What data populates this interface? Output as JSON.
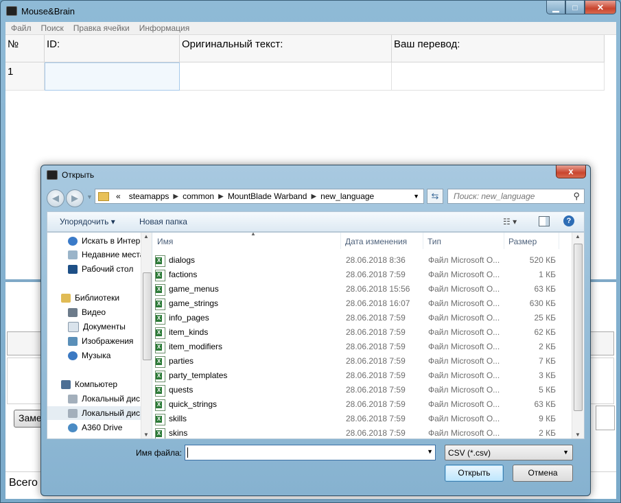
{
  "main_window": {
    "title": "Mouse&Brain",
    "menu": [
      "Файл",
      "Поиск",
      "Правка ячейки",
      "Информация"
    ],
    "grid": {
      "headers": [
        "№",
        "ID:",
        "Оригинальный текст:",
        "Ваш перевод:"
      ],
      "rows": [
        [
          "1",
          "",
          "",
          ""
        ]
      ]
    },
    "replace_button_label": "Заме",
    "status_text": "Всего"
  },
  "dialog": {
    "title": "Открыть",
    "close_label": "x",
    "breadcrumb": [
      "«",
      "steamapps",
      "common",
      "MountBlade Warband",
      "new_language"
    ],
    "search_placeholder": "Поиск: new_language",
    "toolbar": {
      "organize": "Упорядочить",
      "new_folder": "Новая папка"
    },
    "nav_items": [
      {
        "label": "Искать в Интер",
        "icon": "search-icon"
      },
      {
        "label": "Недавние места",
        "icon": "recent-places-icon"
      },
      {
        "label": "Рабочий стол",
        "icon": "desktop-icon"
      },
      {
        "label": "Библиотеки",
        "icon": "libraries-icon"
      },
      {
        "label": "Видео",
        "icon": "video-icon"
      },
      {
        "label": "Документы",
        "icon": "documents-icon"
      },
      {
        "label": "Изображения",
        "icon": "pictures-icon"
      },
      {
        "label": "Музыка",
        "icon": "music-icon"
      },
      {
        "label": "Компьютер",
        "icon": "computer-icon"
      },
      {
        "label": "Локальный дис",
        "icon": "drive-icon"
      },
      {
        "label": "Локальный дис",
        "icon": "drive-icon"
      },
      {
        "label": "A360 Drive",
        "icon": "cloud-drive-icon"
      }
    ],
    "columns": [
      "Имя",
      "Дата изменения",
      "Тип",
      "Размер"
    ],
    "files": [
      {
        "name": "dialogs",
        "date": "28.06.2018 8:36",
        "type": "Файл Microsoft O...",
        "size": "520 КБ"
      },
      {
        "name": "factions",
        "date": "28.06.2018 7:59",
        "type": "Файл Microsoft O...",
        "size": "1 КБ"
      },
      {
        "name": "game_menus",
        "date": "28.06.2018 15:56",
        "type": "Файл Microsoft O...",
        "size": "63 КБ"
      },
      {
        "name": "game_strings",
        "date": "28.06.2018 16:07",
        "type": "Файл Microsoft O...",
        "size": "630 КБ"
      },
      {
        "name": "info_pages",
        "date": "28.06.2018 7:59",
        "type": "Файл Microsoft O...",
        "size": "25 КБ"
      },
      {
        "name": "item_kinds",
        "date": "28.06.2018 7:59",
        "type": "Файл Microsoft O...",
        "size": "62 КБ"
      },
      {
        "name": "item_modifiers",
        "date": "28.06.2018 7:59",
        "type": "Файл Microsoft O...",
        "size": "2 КБ"
      },
      {
        "name": "parties",
        "date": "28.06.2018 7:59",
        "type": "Файл Microsoft O...",
        "size": "7 КБ"
      },
      {
        "name": "party_templates",
        "date": "28.06.2018 7:59",
        "type": "Файл Microsoft O...",
        "size": "3 КБ"
      },
      {
        "name": "quests",
        "date": "28.06.2018 7:59",
        "type": "Файл Microsoft O...",
        "size": "5 КБ"
      },
      {
        "name": "quick_strings",
        "date": "28.06.2018 7:59",
        "type": "Файл Microsoft O...",
        "size": "63 КБ"
      },
      {
        "name": "skills",
        "date": "28.06.2018 7:59",
        "type": "Файл Microsoft O...",
        "size": "9 КБ"
      },
      {
        "name": "skins",
        "date": "28.06.2018 7:59",
        "type": "Файл Microsoft O...",
        "size": "2 КБ"
      }
    ],
    "file_name_label": "Имя файла:",
    "file_name_value": "",
    "file_type": "CSV (*.csv)",
    "open_label": "Открыть",
    "cancel_label": "Отмена"
  },
  "colors": {
    "accent": "#3c7fb1",
    "window_frame": "#8fbad6",
    "close_red": "#c8452e"
  }
}
